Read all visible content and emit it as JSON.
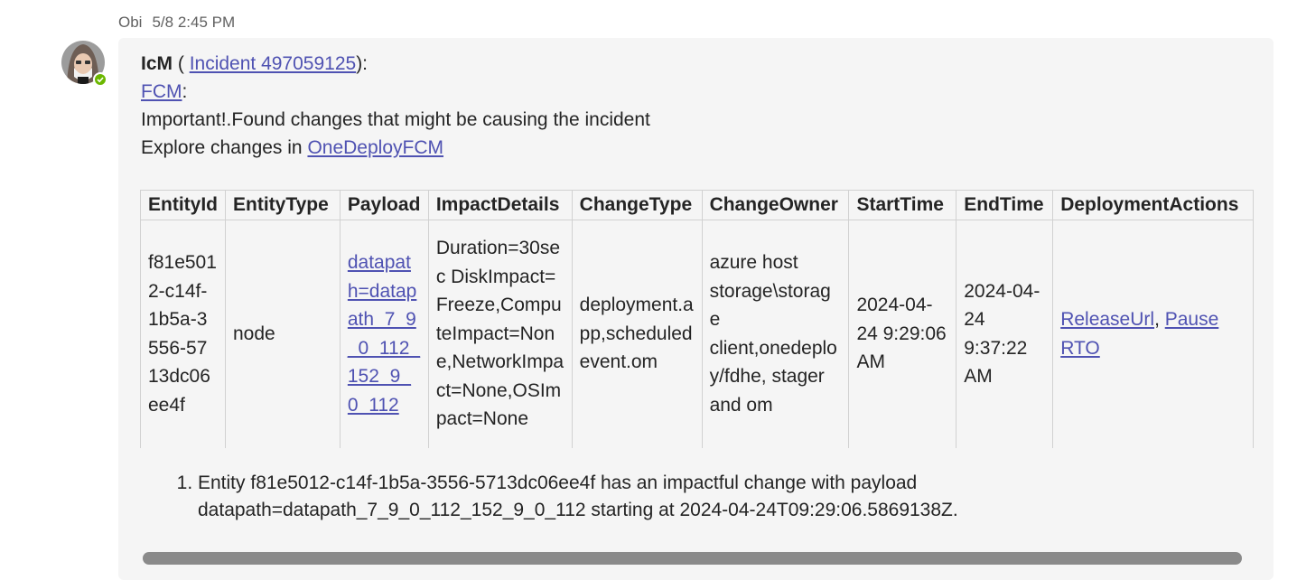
{
  "message": {
    "author": "Obi",
    "timestamp": "5/8 2:45 PM",
    "sender": "IcM",
    "incident_prefix": " ( ",
    "incident_link": "Incident 497059125",
    "incident_suffix": "):",
    "fcm_link": "FCM",
    "fcm_suffix": ":",
    "line_important": "Important!.Found changes that might be causing the incident",
    "explore_prefix": "Explore changes in ",
    "explore_link": "OneDeployFCM"
  },
  "table": {
    "headers": [
      "EntityId",
      "EntityType",
      "Payload",
      "ImpactDetails",
      "ChangeType",
      "ChangeOwner",
      "StartTime",
      "EndTime",
      "DeploymentActions"
    ],
    "row": {
      "entity_id": "f81e5012-c14f-1b5a-3556-5713dc06ee4f",
      "entity_type": "node",
      "payload": "datapath=datapath_7_9_0_112_152_9_0_112",
      "impact_details": "Duration=30sec DiskImpact=Freeze,ComputeImpact=None,NetworkImpact=None,OSImpact=None",
      "change_type": "deployment.app,scheduledevent.om",
      "change_owner": "azure host storage\\storage client,onedeploy/fdhe, stager and om",
      "start_time": "2024-04-24 9:29:06 AM",
      "end_time": "2024-04-24 9:37:22 AM",
      "action_release": "ReleaseUrl",
      "action_sep": ", ",
      "action_pause": "Pause RTO"
    }
  },
  "notes": [
    "Entity f81e5012-c14f-1b5a-3556-5713dc06ee4f has an impactful change with payload datapath=datapath_7_9_0_112_152_9_0_112 starting at 2024-04-24T09:29:06.5869138Z."
  ],
  "colors": {
    "link": "#4f52b2",
    "bubble": "#f5f5f5",
    "presence": "#6bb700"
  }
}
